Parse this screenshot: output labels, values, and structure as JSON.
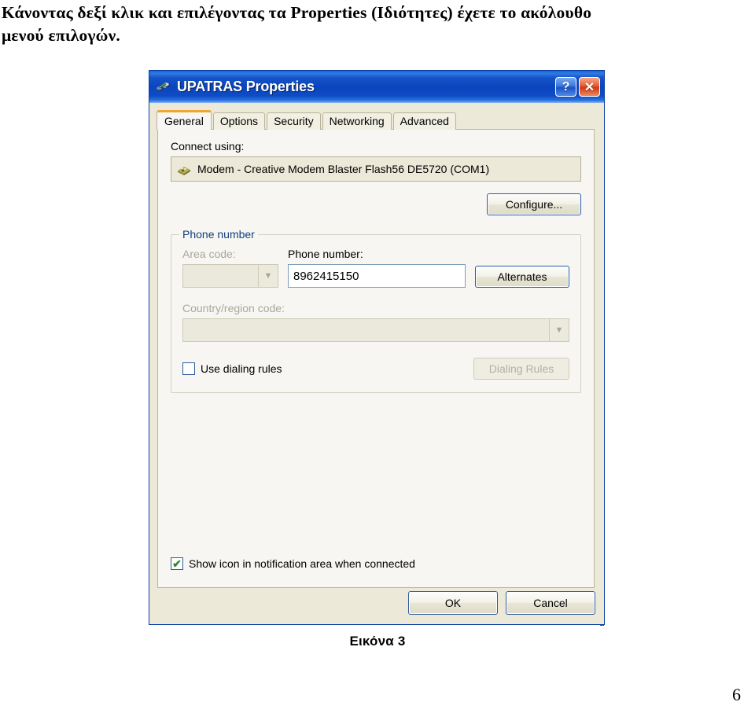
{
  "document": {
    "intro_line1": "Κάνοντας δεξί κλικ και επιλέγοντας τα Properties (Ιδιότητες) έχετε το ακόλουθο",
    "intro_line2": "μενού επιλογών.",
    "figure_caption": "Εικόνα 3",
    "page_number": "6"
  },
  "dialog": {
    "title": "UPATRAS Properties",
    "title_icon": "network-connection-icon",
    "help_button": "?",
    "close_button": "✕",
    "tabs": [
      {
        "label": "General",
        "active": true
      },
      {
        "label": "Options",
        "active": false
      },
      {
        "label": "Security",
        "active": false
      },
      {
        "label": "Networking",
        "active": false
      },
      {
        "label": "Advanced",
        "active": false
      }
    ],
    "connect_using": {
      "label": "Connect using:",
      "device": "Modem - Creative Modem Blaster Flash56 DE5720 (COM1)",
      "device_icon": "modem-icon",
      "configure_button": "Configure..."
    },
    "phone_number_group": {
      "legend": "Phone number",
      "area_code_label": "Area code:",
      "area_code_value": "",
      "area_code_disabled": true,
      "phone_number_label": "Phone number:",
      "phone_number_value": "8962415150",
      "alternates_button": "Alternates",
      "country_label": "Country/region code:",
      "country_value": "",
      "country_disabled": true,
      "use_dialing_rules_label": "Use dialing rules",
      "use_dialing_rules_checked": false,
      "dialing_rules_button": "Dialing Rules",
      "dialing_rules_disabled": true
    },
    "show_icon_label": "Show icon in notification area when connected",
    "show_icon_checked": true,
    "ok_button": "OK",
    "cancel_button": "Cancel"
  },
  "colors": {
    "titlebar_blue": "#0b45bd",
    "dialog_face": "#ece9d8",
    "tab_panel": "#f7f6f2",
    "active_tab_accent": "#f0a732",
    "legend_text": "#12407f",
    "close_button_red": "#d03b12",
    "check_green": "#2a8a2a"
  }
}
